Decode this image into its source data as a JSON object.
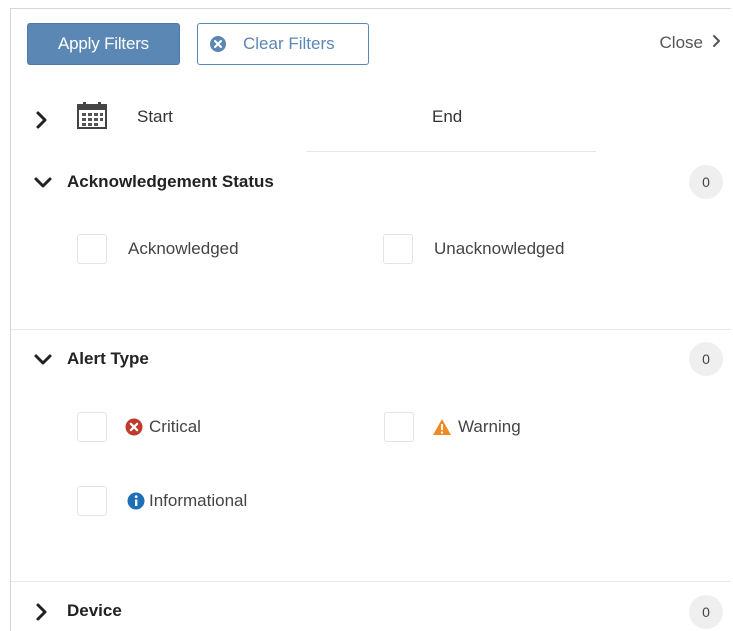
{
  "toolbar": {
    "apply_label": "Apply Filters",
    "clear_label": "Clear Filters",
    "close_label": "Close"
  },
  "date_range": {
    "start_label": "Start",
    "end_label": "End"
  },
  "sections": {
    "ack": {
      "title": "Acknowledgement Status",
      "count": "0",
      "options": [
        "Acknowledged",
        "Unacknowledged"
      ]
    },
    "alert_type": {
      "title": "Alert Type",
      "count": "0",
      "options": [
        {
          "label": "Critical",
          "icon": "error-circle-icon",
          "color": "#c0392b"
        },
        {
          "label": "Warning",
          "icon": "warning-triangle-icon",
          "color": "#f08a24"
        },
        {
          "label": "Informational",
          "icon": "info-circle-icon",
          "color": "#1d6fb8"
        }
      ]
    },
    "device": {
      "title": "Device",
      "count": "0"
    }
  },
  "colors": {
    "primary": "#5b87b5",
    "critical": "#c0392b",
    "warning": "#f08a24",
    "info": "#1d6fb8"
  }
}
